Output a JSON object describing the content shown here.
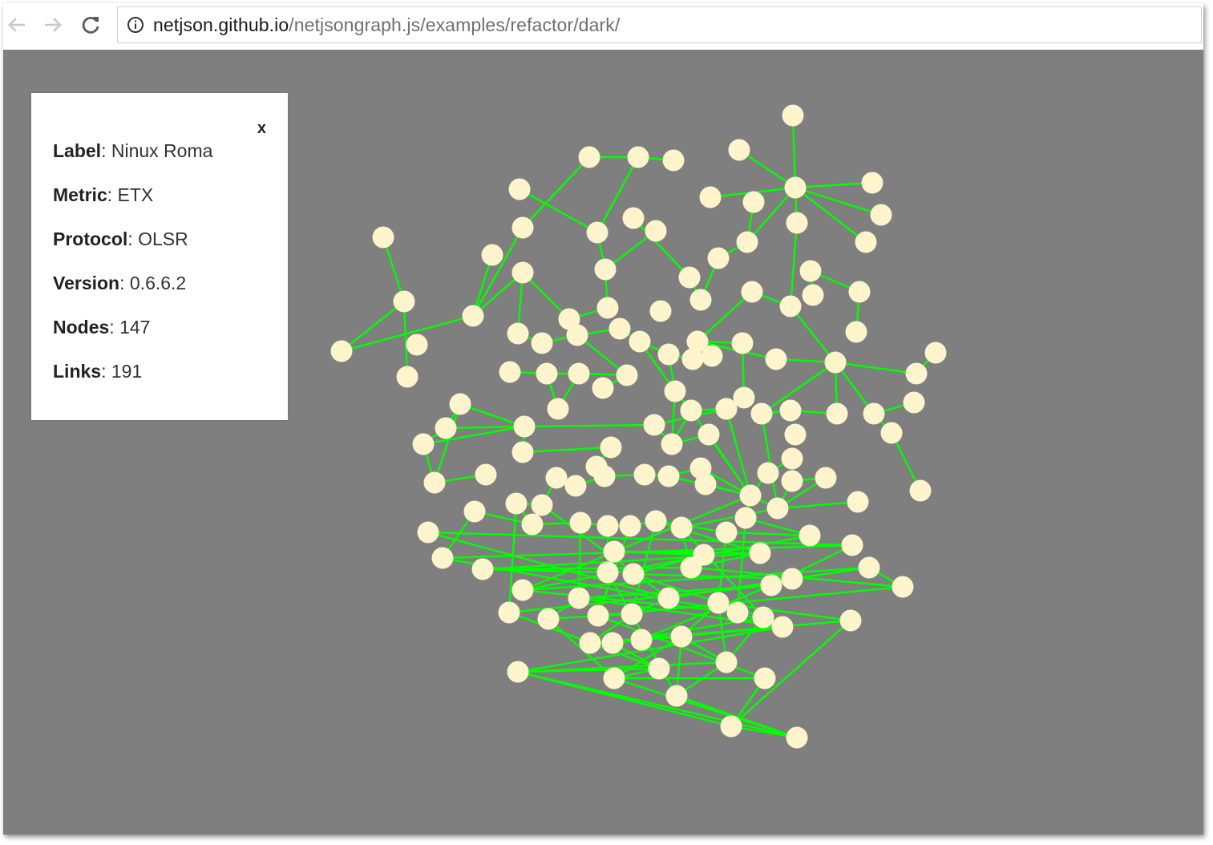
{
  "browser": {
    "url_host": "netjson.github.io",
    "url_path": "/netjsongraph.js/examples/refactor/dark/",
    "icons": {
      "back": "back-arrow-icon",
      "forward": "forward-arrow-icon",
      "reload": "reload-icon",
      "info": "info-icon"
    }
  },
  "panel": {
    "close_label": "x",
    "rows": [
      {
        "key": "Label",
        "sep": ": ",
        "value": "Ninux Roma"
      },
      {
        "key": "Metric",
        "sep": ": ",
        "value": "ETX"
      },
      {
        "key": "Protocol",
        "sep": ": ",
        "value": "OLSR"
      },
      {
        "key": "Version",
        "sep": ": ",
        "value": "0.6.6.2"
      },
      {
        "key": "Nodes",
        "sep": ": ",
        "value": "147"
      },
      {
        "key": "Links",
        "sep": ": ",
        "value": "191"
      }
    ]
  },
  "colors": {
    "background": "#7f7f7f",
    "node_fill": "#fff4cc",
    "link_stroke": "#00ff00"
  }
}
